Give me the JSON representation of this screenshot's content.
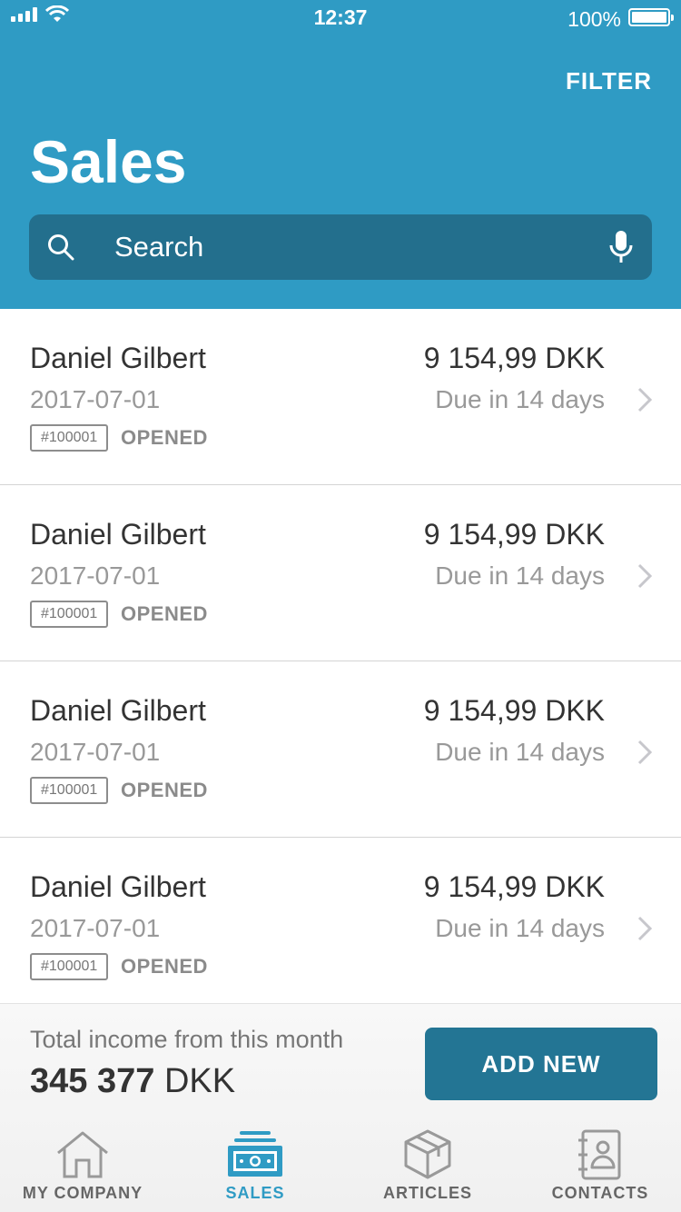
{
  "status_bar": {
    "time": "12:37",
    "battery": "100%"
  },
  "header": {
    "filter_label": "FILTER",
    "title": "Sales"
  },
  "search": {
    "placeholder": "Search"
  },
  "invoices": [
    {
      "name": "Daniel Gilbert",
      "date": "2017-07-01",
      "number": "#100001",
      "status": "OPENED",
      "amount": "9 154,99 DKK",
      "due": "Due in 14 days"
    },
    {
      "name": "Daniel Gilbert",
      "date": "2017-07-01",
      "number": "#100001",
      "status": "OPENED",
      "amount": "9 154,99 DKK",
      "due": "Due in 14 days"
    },
    {
      "name": "Daniel Gilbert",
      "date": "2017-07-01",
      "number": "#100001",
      "status": "OPENED",
      "amount": "9 154,99 DKK",
      "due": "Due in 14 days"
    },
    {
      "name": "Daniel Gilbert",
      "date": "2017-07-01",
      "number": "#100001",
      "status": "OPENED",
      "amount": "9 154,99 DKK",
      "due": "Due in 14 days"
    }
  ],
  "footer": {
    "total_label": "Total income from this month",
    "total_value": "345 377",
    "total_currency": "DKK",
    "add_new_label": "ADD NEW"
  },
  "tabs": [
    {
      "label": "MY COMPANY",
      "icon": "house-icon",
      "active": false
    },
    {
      "label": "SALES",
      "icon": "cash-icon",
      "active": true
    },
    {
      "label": "ARTICLES",
      "icon": "box-icon",
      "active": false
    },
    {
      "label": "CONTACTS",
      "icon": "contact-book-icon",
      "active": false
    }
  ],
  "colors": {
    "header_bg": "#2f9bc4",
    "search_bg": "#236f8d",
    "button_bg": "#237594",
    "active_tab": "#2f9bc4"
  }
}
